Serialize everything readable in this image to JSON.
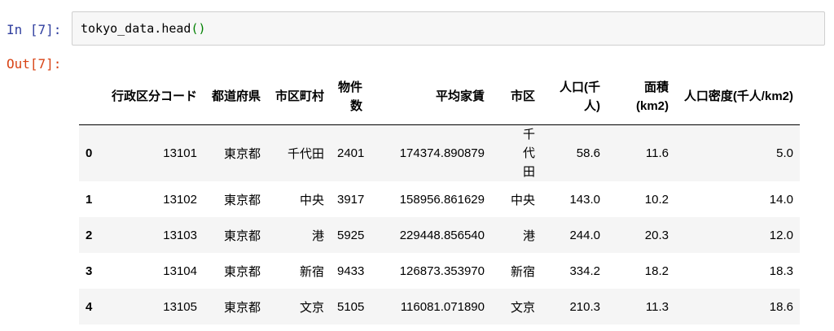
{
  "notebook": {
    "in_prompt": "In [7]:",
    "out_prompt": "Out[7]:",
    "code": {
      "prefix": "tokyo_data.head",
      "parens": "()"
    }
  },
  "dataframe": {
    "columns": [
      "",
      "行政区分コード",
      "都道府県",
      "市区町村",
      "物件数",
      "平均家賃",
      "市区",
      "人口(千人)",
      "面積(km2)",
      "人口密度(千人/km2)"
    ],
    "rows": [
      [
        "0",
        "13101",
        "東京都",
        "千代田",
        "2401",
        "174374.890879",
        "千代田",
        "58.6",
        "11.6",
        "5.0"
      ],
      [
        "1",
        "13102",
        "東京都",
        "中央",
        "3917",
        "158956.861629",
        "中央",
        "143.0",
        "10.2",
        "14.0"
      ],
      [
        "2",
        "13103",
        "東京都",
        "港",
        "5925",
        "229448.856540",
        "港",
        "244.0",
        "20.3",
        "12.0"
      ],
      [
        "3",
        "13104",
        "東京都",
        "新宿",
        "9433",
        "126873.353970",
        "新宿",
        "334.2",
        "18.2",
        "18.3"
      ],
      [
        "4",
        "13105",
        "東京都",
        "文京",
        "5105",
        "116081.071890",
        "文京",
        "210.3",
        "11.3",
        "18.6"
      ]
    ]
  }
}
